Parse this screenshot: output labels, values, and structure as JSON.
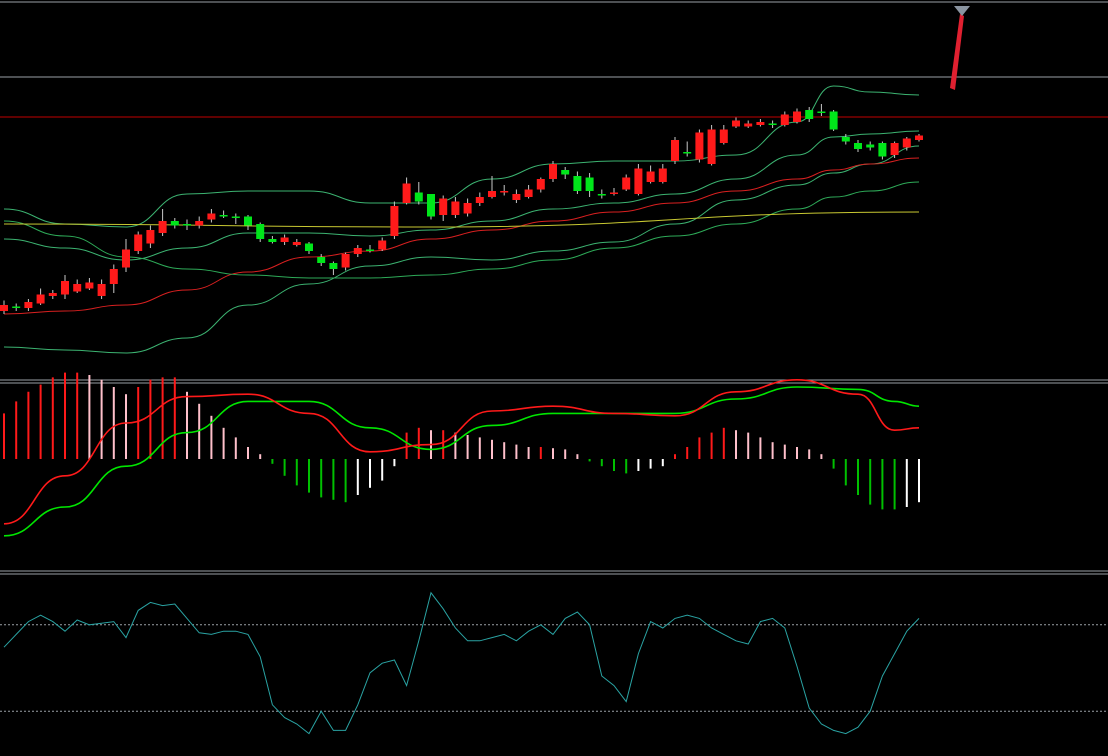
{
  "colors": {
    "background": "#000000",
    "candle_up": "#ff1a1a",
    "candle_down": "#00e61a",
    "wick": "#c8c8c8",
    "bollinger": "#3cb371",
    "ma_red": "#d92020",
    "ma_yellow": "#c8c832",
    "ma_green": "#2eaa58",
    "macd_dif": "#00e600",
    "macd_dea": "#ff1a1a",
    "macd_hist_pos": "#ff1a1a",
    "macd_hist_pos_fade": "#ffc0cb",
    "macd_hist_neg": "#00c000",
    "macd_hist_neg_fade": "#ffffff",
    "oscillator": "#2aa3a3",
    "gridline": "#9aa0a6",
    "level_red": "#c00000",
    "arrow": "#e02030"
  },
  "chart_data": [
    {
      "type": "candlestick",
      "panel": "price",
      "ylim": [
        0,
        100
      ],
      "x": [
        1,
        2,
        3,
        4,
        5,
        6,
        7,
        8,
        9,
        10,
        11,
        12,
        13,
        14,
        15,
        16,
        17,
        18,
        19,
        20,
        21,
        22,
        23,
        24,
        25,
        26,
        27,
        28,
        29,
        30,
        31,
        32,
        33,
        34,
        35,
        36,
        37,
        38,
        39,
        40,
        41,
        42,
        43,
        44,
        45,
        46,
        47,
        48,
        49,
        50,
        51,
        52,
        53,
        54,
        55,
        56,
        57,
        58,
        59,
        60,
        61,
        62,
        63,
        64,
        65,
        66,
        67,
        68,
        69,
        70,
        71,
        72,
        73,
        74,
        75,
        76
      ],
      "open": [
        23.0,
        24.5,
        24.0,
        25.5,
        28.0,
        28.5,
        29.5,
        30.5,
        28.0,
        32.0,
        37.5,
        43.0,
        45.5,
        49.0,
        53.0,
        52.0,
        51.5,
        53.5,
        55.0,
        54.5,
        54.5,
        52.0,
        47.0,
        46.0,
        45.0,
        45.5,
        41.0,
        39.0,
        37.5,
        42.0,
        43.5,
        43.5,
        48.0,
        59.0,
        62.5,
        62.0,
        55.0,
        55.0,
        55.5,
        59.0,
        61.0,
        62.5,
        60.0,
        61.0,
        63.5,
        67.0,
        70.0,
        68.0,
        67.5,
        62.0,
        62.5,
        63.5,
        62.0,
        66.0,
        66.0,
        73.0,
        76.0,
        73.5,
        72.0,
        79.0,
        84.5,
        84.5,
        85.0,
        85.5,
        85.0,
        86.0,
        90.0,
        89.5,
        89.5,
        81.0,
        79.0,
        78.5,
        79.0,
        75.0,
        77.5,
        80.0
      ],
      "close": [
        25.0,
        24.0,
        26.0,
        28.5,
        29.0,
        33.0,
        32.0,
        32.5,
        32.0,
        37.0,
        43.5,
        48.5,
        50.0,
        53.0,
        51.5,
        51.5,
        53.0,
        55.5,
        54.5,
        54.0,
        51.5,
        47.0,
        46.0,
        47.5,
        46.0,
        43.0,
        39.0,
        37.0,
        42.0,
        44.0,
        43.0,
        46.5,
        58.0,
        65.5,
        59.5,
        54.5,
        60.5,
        59.5,
        59.0,
        61.0,
        63.0,
        63.0,
        62.0,
        63.5,
        67.0,
        72.0,
        68.5,
        63.0,
        63.0,
        61.5,
        62.5,
        67.5,
        70.5,
        69.5,
        70.5,
        80.0,
        75.5,
        82.5,
        83.5,
        83.5,
        86.5,
        85.5,
        86.0,
        85.0,
        88.5,
        89.5,
        87.0,
        89.0,
        83.5,
        79.5,
        77.0,
        77.5,
        74.5,
        79.0,
        80.5,
        81.5
      ],
      "high": [
        26.5,
        25.5,
        27.0,
        30.5,
        30.0,
        35.0,
        33.5,
        34.0,
        33.5,
        38.5,
        47.0,
        49.5,
        51.5,
        57.0,
        54.0,
        53.5,
        54.5,
        57.0,
        56.5,
        55.5,
        55.0,
        52.5,
        48.0,
        48.5,
        47.0,
        46.0,
        42.0,
        39.5,
        42.5,
        45.0,
        45.0,
        47.5,
        59.5,
        67.5,
        66.0,
        62.0,
        61.5,
        61.0,
        60.5,
        62.5,
        68.0,
        65.0,
        63.5,
        65.0,
        67.5,
        73.0,
        71.0,
        69.5,
        69.0,
        63.5,
        64.0,
        68.5,
        72.0,
        71.5,
        72.0,
        81.0,
        79.5,
        83.5,
        85.0,
        85.0,
        87.5,
        86.5,
        87.0,
        86.5,
        89.5,
        90.5,
        91.0,
        92.0,
        90.0,
        82.0,
        80.0,
        79.5,
        79.5,
        79.5,
        81.0,
        82.0
      ],
      "low": [
        22.0,
        23.0,
        23.0,
        25.0,
        27.0,
        27.0,
        29.0,
        30.0,
        27.0,
        29.0,
        36.0,
        42.0,
        44.0,
        48.0,
        50.5,
        50.0,
        50.5,
        52.5,
        54.0,
        52.0,
        50.0,
        46.0,
        45.5,
        45.0,
        44.5,
        42.0,
        38.0,
        35.0,
        36.5,
        41.0,
        42.5,
        43.0,
        47.0,
        58.5,
        58.5,
        53.5,
        53.0,
        54.0,
        54.5,
        58.0,
        60.5,
        61.5,
        59.0,
        60.5,
        62.5,
        66.0,
        67.0,
        62.0,
        61.0,
        60.5,
        61.5,
        63.0,
        61.5,
        65.5,
        65.5,
        72.0,
        74.5,
        72.5,
        71.5,
        78.5,
        84.0,
        84.0,
        84.5,
        84.0,
        84.5,
        85.5,
        86.0,
        88.0,
        83.0,
        78.5,
        76.0,
        76.5,
        73.5,
        74.0,
        76.5,
        79.5
      ]
    },
    {
      "type": "line",
      "panel": "price",
      "series": [
        {
          "role": "bollinger-upper",
          "x": [
            1,
            6,
            11,
            16,
            21,
            26,
            31,
            36,
            41,
            46,
            51,
            56,
            61,
            66,
            69,
            72,
            76
          ],
          "values": [
            57,
            52,
            51,
            62,
            63,
            63,
            59,
            59,
            67,
            72,
            73,
            73,
            75,
            86,
            98,
            96,
            95
          ]
        },
        {
          "role": "bollinger-middle",
          "x": [
            1,
            6,
            11,
            16,
            21,
            26,
            31,
            36,
            41,
            46,
            51,
            56,
            61,
            66,
            69,
            72,
            76
          ],
          "values": [
            47,
            44,
            40,
            44,
            49,
            49,
            48,
            50,
            53,
            57,
            59,
            62,
            67,
            75,
            81,
            82,
            83
          ]
        },
        {
          "role": "bollinger-lower",
          "x": [
            1,
            6,
            11,
            16,
            21,
            26,
            31,
            36,
            41,
            46,
            51,
            56,
            61,
            66,
            69,
            72,
            76
          ],
          "values": [
            11,
            10,
            9,
            14,
            25,
            32,
            38,
            41,
            40,
            43,
            46,
            52,
            60,
            65,
            69,
            72,
            78
          ]
        },
        {
          "role": "ma-red",
          "x": [
            1,
            6,
            11,
            16,
            21,
            26,
            31,
            36,
            41,
            46,
            51,
            56,
            61,
            66,
            69,
            72,
            76
          ],
          "values": [
            22,
            23,
            25,
            30,
            36,
            41,
            43,
            47,
            50,
            53,
            56,
            59,
            63,
            67,
            70,
            72,
            74
          ]
        },
        {
          "role": "ma-green",
          "x": [
            1,
            6,
            11,
            16,
            21,
            26,
            31,
            36,
            41,
            46,
            51,
            56,
            61,
            66,
            69,
            72,
            76
          ],
          "values": [
            53,
            48,
            41,
            37,
            35,
            34,
            34,
            35,
            37,
            40,
            44,
            48,
            52,
            57,
            61,
            63,
            66
          ]
        },
        {
          "role": "ma-yellow",
          "x": [
            1,
            36,
            76
          ],
          "values": [
            52,
            51,
            56
          ]
        }
      ]
    },
    {
      "type": "bar",
      "panel": "macd",
      "ylim": [
        -1,
        1
      ],
      "x": [
        1,
        2,
        3,
        4,
        5,
        6,
        7,
        8,
        9,
        10,
        11,
        12,
        13,
        14,
        15,
        16,
        17,
        18,
        19,
        20,
        21,
        22,
        23,
        24,
        25,
        26,
        27,
        28,
        29,
        30,
        31,
        32,
        33,
        34,
        35,
        36,
        37,
        38,
        39,
        40,
        41,
        42,
        43,
        44,
        45,
        46,
        47,
        48,
        49,
        50,
        51,
        52,
        53,
        54,
        55,
        56,
        57,
        58,
        59,
        60,
        61,
        62,
        63,
        64,
        65,
        66,
        67,
        68,
        69,
        70,
        71,
        72,
        73,
        74,
        75,
        76
      ],
      "values": [
        0.38,
        0.48,
        0.56,
        0.62,
        0.68,
        0.72,
        0.72,
        0.7,
        0.66,
        0.6,
        0.54,
        0.6,
        0.66,
        0.68,
        0.68,
        0.56,
        0.46,
        0.36,
        0.26,
        0.18,
        0.1,
        0.04,
        -0.04,
        -0.14,
        -0.22,
        -0.28,
        -0.32,
        -0.34,
        -0.36,
        -0.3,
        -0.24,
        -0.18,
        -0.06,
        0.22,
        0.26,
        0.24,
        0.24,
        0.22,
        0.2,
        0.18,
        0.16,
        0.14,
        0.12,
        0.1,
        0.1,
        0.09,
        0.08,
        0.04,
        -0.02,
        -0.06,
        -0.1,
        -0.12,
        -0.1,
        -0.08,
        -0.06,
        0.04,
        0.1,
        0.18,
        0.22,
        0.26,
        0.24,
        0.22,
        0.18,
        0.14,
        0.12,
        0.1,
        0.08,
        0.04,
        -0.08,
        -0.22,
        -0.3,
        -0.38,
        -0.42,
        -0.42,
        -0.4,
        -0.36
      ]
    },
    {
      "type": "line",
      "panel": "macd",
      "ylim": [
        -1,
        1
      ],
      "series": [
        {
          "role": "dif",
          "x": [
            1,
            6,
            11,
            16,
            21,
            26,
            31,
            36,
            41,
            46,
            51,
            56,
            61,
            66,
            71,
            74,
            76
          ],
          "values": [
            -0.64,
            -0.4,
            -0.06,
            0.22,
            0.48,
            0.48,
            0.26,
            0.08,
            0.28,
            0.38,
            0.38,
            0.38,
            0.5,
            0.6,
            0.58,
            0.48,
            0.44
          ]
        },
        {
          "role": "dea",
          "x": [
            1,
            6,
            11,
            16,
            21,
            26,
            31,
            36,
            41,
            46,
            51,
            56,
            61,
            66,
            71,
            74,
            76
          ],
          "values": [
            -0.54,
            -0.14,
            0.3,
            0.52,
            0.54,
            0.38,
            0.06,
            0.12,
            0.4,
            0.44,
            0.38,
            0.36,
            0.56,
            0.66,
            0.54,
            0.24,
            0.26
          ]
        }
      ]
    },
    {
      "type": "line",
      "panel": "oscillator",
      "ylim": [
        0,
        100
      ],
      "reference_lines": [
        72,
        18
      ],
      "series": [
        {
          "role": "oscillator",
          "x": [
            1,
            2,
            3,
            4,
            5,
            6,
            7,
            8,
            9,
            10,
            11,
            12,
            13,
            14,
            15,
            16,
            17,
            18,
            19,
            20,
            21,
            22,
            23,
            24,
            25,
            26,
            27,
            28,
            29,
            30,
            31,
            32,
            33,
            34,
            35,
            36,
            37,
            38,
            39,
            40,
            41,
            42,
            43,
            44,
            45,
            46,
            47,
            48,
            49,
            50,
            51,
            52,
            53,
            54,
            55,
            56,
            57,
            58,
            59,
            60,
            61,
            62,
            63,
            64,
            65,
            66,
            67,
            68,
            69,
            70,
            71,
            72,
            73,
            74,
            75,
            76
          ],
          "values": [
            58,
            66,
            74,
            78,
            74,
            68,
            75,
            72,
            73,
            74,
            64,
            81,
            86,
            84,
            85,
            76,
            67,
            66,
            68,
            68,
            66,
            52,
            22,
            14,
            10,
            4,
            18,
            6,
            6,
            22,
            42,
            48,
            50,
            34,
            62,
            92,
            82,
            70,
            62,
            62,
            64,
            66,
            62,
            68,
            72,
            66,
            76,
            80,
            72,
            40,
            34,
            24,
            54,
            74,
            70,
            76,
            78,
            76,
            70,
            66,
            62,
            60,
            74,
            76,
            70,
            46,
            20,
            10,
            6,
            4,
            8,
            18,
            40,
            54,
            68,
            76
          ]
        }
      ]
    }
  ]
}
